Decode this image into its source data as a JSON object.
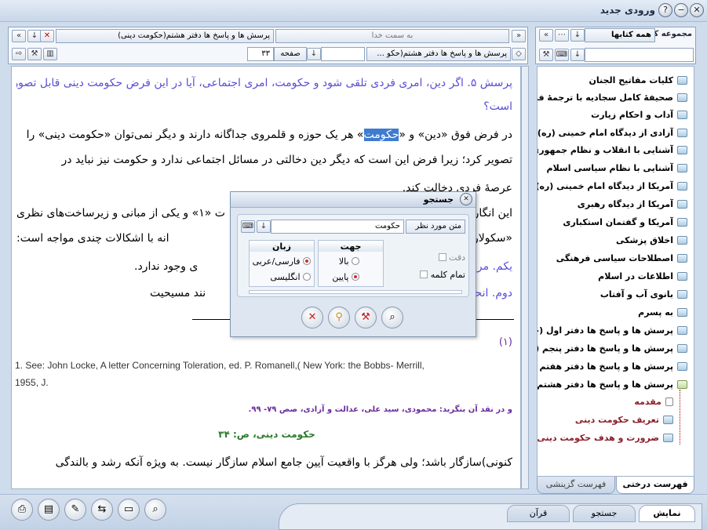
{
  "window": {
    "title": "ورودی جدید"
  },
  "doc_toolbar": {
    "nav_direction": "به سمت خدا",
    "doc_title": "پرسش ها و پاسخ ها دفتر هشتم(حکومت دینی)",
    "book_select": "پرسش ها و پاسخ ها دفتر هشتم(حکو ...",
    "page_label": "صفحه",
    "page_value": "۳۳"
  },
  "content": {
    "question": "پرسش ۵. اگر دین، امری فردی تلقی شود و حکومت، امری اجتماعی، آیا در این فرض حکومت دینی قابل تصور",
    "question_end": "است؟",
    "l1_pre": "در فرض فوق «دین» و «",
    "l1_hl": "حکومت",
    "l1_post": "» هر یک حوزه و قلمروی جداگانه دارند و دیگر نمی‌توان «حکومت دینی» را",
    "l2": "تصویر کرد؛ زیرا فرض این است که دیگر دین دخالتی در مسائل اجتماعی ندارد و حکومت نیز نباید در",
    "l3": "عرصهٔ فردی دخالت کند.",
    "l4_right": "این انگار",
    "l4_left": "ت «۱» و یکی از مبانی و زیرساخت‌های نظری",
    "l5_right": "«سکولار",
    "l5_left": "انه با اشکالات چندی مواجه است:",
    "l6_right": "یکم. مرز",
    "l6_left": "ی وجود ندارد.",
    "l7_right": "دوم. انحص",
    "l7_left": "نند مسیحیت",
    "fn_num": "(۱)",
    "fn_en1": "1. See: John Locke, A letter Concerning Toleration, ed. P. Romanell,( New York: the Bobbs- Merrill,",
    "fn_en2": "1955, J.",
    "fn_fa": "و در نقد آن بنگرید: محمودی، سید علی، عدالت و آزادی، صص ۷۹- ۹۹.",
    "page_ref": "حکومت دینی، ص: ۳۴",
    "l8": "کنونی)سازگار باشد؛ ولی هرگز با واقعیت آیین جامع اسلام سازگار نیست. به ویژه آنکه رشد و بالندگی"
  },
  "sidebar": {
    "collection_label": "مجموعه کتب",
    "collection_value": "همه کتابها",
    "items": [
      "کلیات مفاتیح الجنان",
      "صحیفهٔ کامل سجادیه با ترجمهٔ فارسی",
      "آداب و احکام زیارت",
      "آزادی از دیدگاه امام خمینی (ره)",
      "آشنایی با انقلاب و نظام جمهوری اسلامی",
      "آشنایی با نظام سیاسی اسلام",
      "آمریکا از دیدگاه امام خمینی (ره)",
      "آمریکا از دیدگاه رهبری",
      "آمریکا و گفتمان استکباری",
      "اخلاق پزشکی",
      "اصطلاحات سیاسی فرهنگی",
      "اطلاعات در اسلام",
      "بانوی آب و آفتاب",
      "به پسرم",
      "پرسش ها و پاسخ ها دفتر اول (خداشناسی)",
      "پرسش ها و پاسخ ها دفتر پنجم (قرآن)",
      "پرسش ها و پاسخ ها دفتر هفتم (پرسش)",
      "پرسش ها و پاسخ ها دفتر هشتم (حکومت دینی)"
    ],
    "sub_items": [
      "مقدمه",
      "تعریف حکومت دینی",
      "ضرورت و هدف حکومت دینی"
    ],
    "tabs": [
      "فهرست درختی",
      "فهرست گزینشی"
    ]
  },
  "bottom_tabs": [
    "نمایش",
    "جستجو",
    "قرآن"
  ],
  "search_dialog": {
    "title": "جستجو",
    "label": "متن مورد نظر",
    "value": "حکومت",
    "direction_title": "جهت",
    "dir_up": "بالا",
    "dir_down": "پایین",
    "lang_title": "زبان",
    "lang_fa": "فارسی/عربی",
    "lang_en": "انگلیسی",
    "exact": "دقت",
    "whole_word": "تمام کلمه"
  }
}
